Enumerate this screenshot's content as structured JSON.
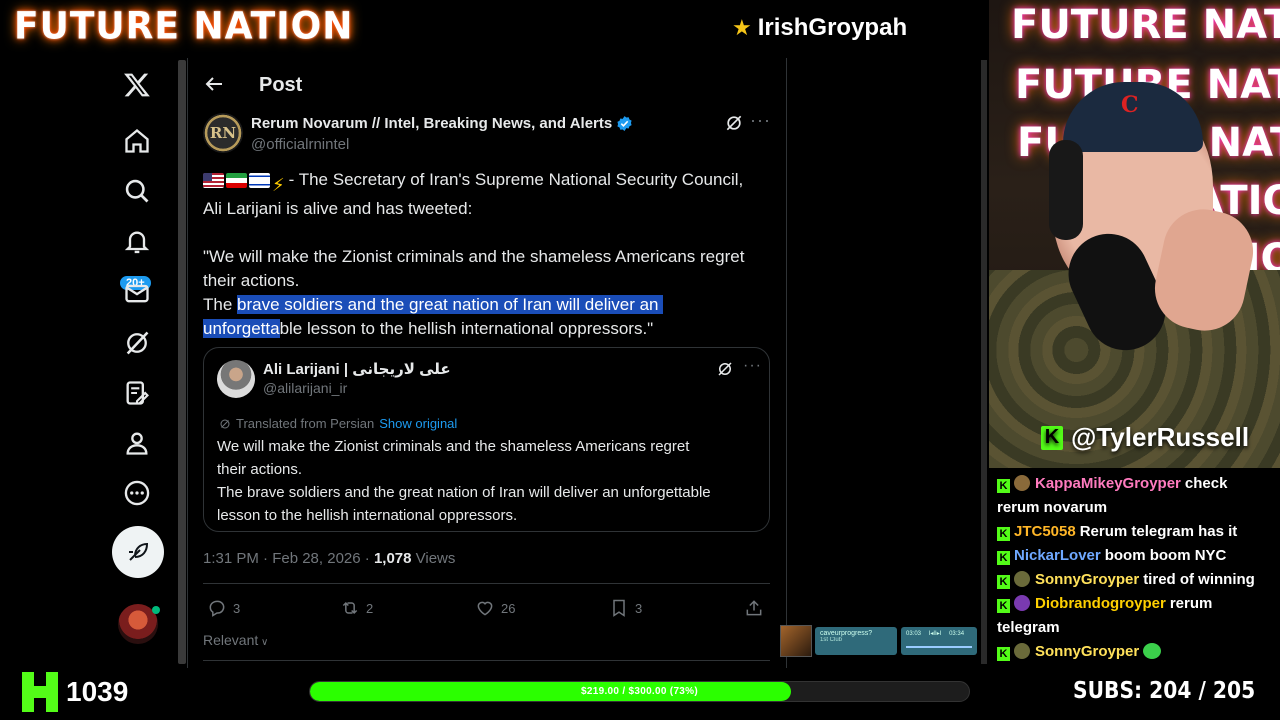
{
  "overlay": {
    "brand": "FUTURE NATION",
    "streamer": "IrishGroypah",
    "cam_neon": [
      "FUTURE NATION",
      "FUTURE NATION",
      "FUTURE NATION",
      "NATION",
      "NATION"
    ],
    "cam_user": "@TylerRussell",
    "viewer_count": "1039",
    "goal_text": "$219.00 / $300.00 (73%)",
    "goal_progress": 0.73,
    "subs_label": "SUBS:",
    "subs_value": "204 / 205",
    "mini_track": "caveurprogress?",
    "mini_sub": "1st Club",
    "mini_time_a": "03:03",
    "mini_time_b": "03:34"
  },
  "nav": {
    "items": [
      "x-logo-icon",
      "home-icon",
      "search-icon",
      "notifications-icon",
      "messages-icon",
      "grok-icon",
      "articles-icon",
      "profile-icon",
      "more-icon"
    ],
    "messages_badge": "20+"
  },
  "post": {
    "header_title": "Post",
    "author_name": "Rerum Novarum // Intel, Breaking News, and Alerts",
    "author_handle": "@officialrnintel",
    "avatar_initials": "RN",
    "text_line1": "- The Secretary of Iran's Supreme National Security Council,",
    "text_line2": "Ali Larijani is alive and has tweeted:",
    "text_line3": "\"We will make the Zionist criminals and the shameless Americans regret",
    "text_line4": "their actions.",
    "text_line5_pre": "The ",
    "text_line5_hl": "brave soldiers and the great nation of Iran will deliver an ",
    "text_line6_hl": "unforgetta",
    "text_line6_post": "ble lesson to the hellish international oppressors.\"",
    "timestamp": "1:31 PM · Feb 28, 2026 · ",
    "views_count": "1,078",
    "views_label": " Views",
    "replies": "3",
    "reposts": "2",
    "likes": "26",
    "bookmarks": "3",
    "sort_label": "Relevant"
  },
  "quote": {
    "name": "Ali Larijani | علی لاریجانی",
    "handle": "@alilarijani_ir",
    "translated": "Translated from Persian",
    "show_original": "Show original",
    "line1": "We will make the Zionist criminals and the shameless Americans regret",
    "line2": "their actions.",
    "line3": "The brave soldiers and the great nation of Iran will deliver an unforgettable",
    "line4": "lesson to the hellish international oppressors."
  },
  "chat": [
    {
      "user": "KappaMikeyGroyper",
      "color": "#ff7bbf",
      "text": "check rerum novarum",
      "emote": "#8a6a3a"
    },
    {
      "user": "JTC5058",
      "color": "#ffb627",
      "text": "Rerum telegram has it",
      "emote": ""
    },
    {
      "user": "NickarLover",
      "color": "#6fa8ff",
      "text": "boom boom NYC",
      "emote": ""
    },
    {
      "user": "SonnyGroyper",
      "color": "#ffe15a",
      "text": "tired of winning",
      "emote": "#6a6a3a"
    },
    {
      "user": "Diobrandogroyper",
      "color": "#ffd000",
      "text": "rerum telegram",
      "emote": "#7a3ab0"
    },
    {
      "user": "SonnyGroyper",
      "color": "#ffe15a",
      "text": "",
      "emote": "#6a6a3a"
    }
  ],
  "colors": {
    "x_blue": "#1d9bf0",
    "kick_green": "#53fc18",
    "selection": "#1a4db8"
  }
}
